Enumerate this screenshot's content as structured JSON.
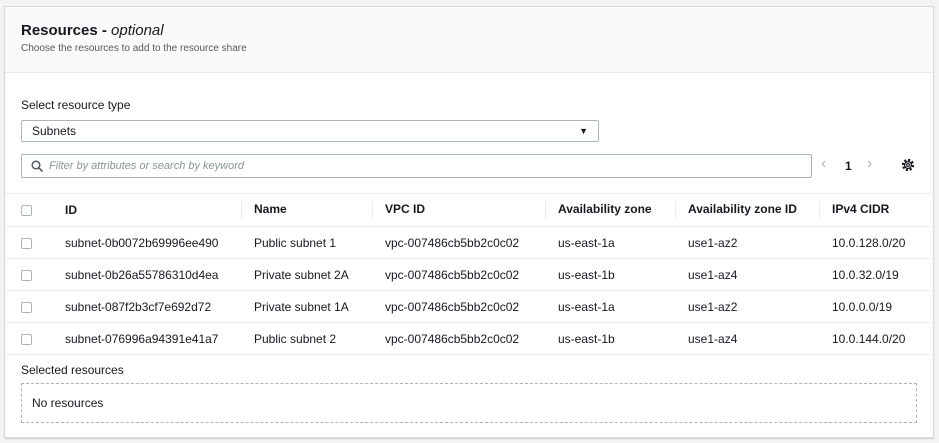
{
  "header": {
    "title": "Resources - ",
    "title_optional": "optional",
    "description": "Choose the resources to add to the resource share"
  },
  "resource_type": {
    "label": "Select resource type",
    "selected": "Subnets"
  },
  "filter": {
    "placeholder": "Filter by attributes or search by keyword"
  },
  "pagination": {
    "current_page": "1"
  },
  "table": {
    "columns": [
      "ID",
      "Name",
      "VPC ID",
      "Availability zone",
      "Availability zone ID",
      "IPv4 CIDR"
    ],
    "rows": [
      [
        "subnet-0b0072b69996ee490",
        "Public subnet 1",
        "vpc-007486cb5bb2c0c02",
        "us-east-1a",
        "use1-az2",
        "10.0.128.0/20"
      ],
      [
        "subnet-0b26a55786310d4ea",
        "Private subnet 2A",
        "vpc-007486cb5bb2c0c02",
        "us-east-1b",
        "use1-az4",
        "10.0.32.0/19"
      ],
      [
        "subnet-087f2b3cf7e692d72",
        "Private subnet 1A",
        "vpc-007486cb5bb2c0c02",
        "us-east-1a",
        "use1-az2",
        "10.0.0.0/19"
      ],
      [
        "subnet-076996a94391e41a7",
        "Public subnet 2",
        "vpc-007486cb5bb2c0c02",
        "us-east-1b",
        "use1-az4",
        "10.0.144.0/20"
      ]
    ]
  },
  "selected_resources": {
    "label": "Selected resources",
    "empty_text": "No resources"
  },
  "icons": {
    "search": "search-icon",
    "caret": "caret-down-icon",
    "prev": "chevron-left-icon",
    "next": "chevron-right-icon",
    "settings": "gear-icon"
  }
}
